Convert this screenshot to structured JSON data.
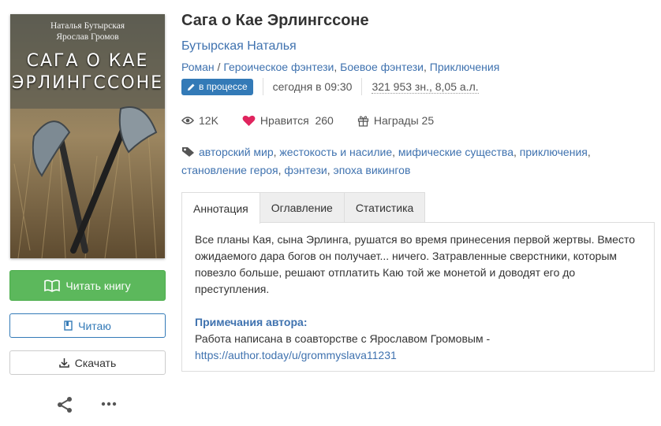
{
  "cover": {
    "authors": [
      "Наталья Бутырская",
      "Ярослав Громов"
    ],
    "title_lines": [
      "САГА О КАЕ",
      "ЭРЛИНГССОНЕ"
    ]
  },
  "sidebar": {
    "read_label": "Читать книгу",
    "reading_label": "Читаю",
    "download_label": "Скачать"
  },
  "book": {
    "title": "Сага о Кае Эрлингссоне",
    "author": "Бутырская Наталья",
    "form": "Роман",
    "genres": [
      "Героическое фэнтези",
      "Боевое фэнтези",
      "Приключения"
    ],
    "status": "в процессе",
    "updated": "сегодня в 09:30",
    "size": "321 953 зн., 8,05 а.л."
  },
  "stats": {
    "views": "12K",
    "likes_label": "Нравится",
    "likes": "260",
    "awards_label": "Награды",
    "awards": "25"
  },
  "tags": [
    "авторский мир",
    "жестокость и насилие",
    "мифические существа",
    "приключения",
    "становление героя",
    "фэнтези",
    "эпоха викингов"
  ],
  "tabs": [
    "Аннотация",
    "Оглавление",
    "Статистика"
  ],
  "annotation": {
    "text": "Все планы Кая, сына Эрлинга, рушатся во время принесения первой жертвы. Вместо ожидаемого дара богов он получает... ничего. Затравленные сверстники, которым повезло больше, решают отплатить Каю той же монетой и доводят его до преступления.",
    "notes_title": "Примечания автора:",
    "notes_text": "Работа написана в соавторстве с Ярославом Громовым -",
    "notes_link": "https://author.today/u/grommyslava11231"
  },
  "colors": {
    "accent": "#3f72af",
    "read_button": "#5cb85c",
    "badge": "#337ab7",
    "like_heart": "#e0245e"
  }
}
